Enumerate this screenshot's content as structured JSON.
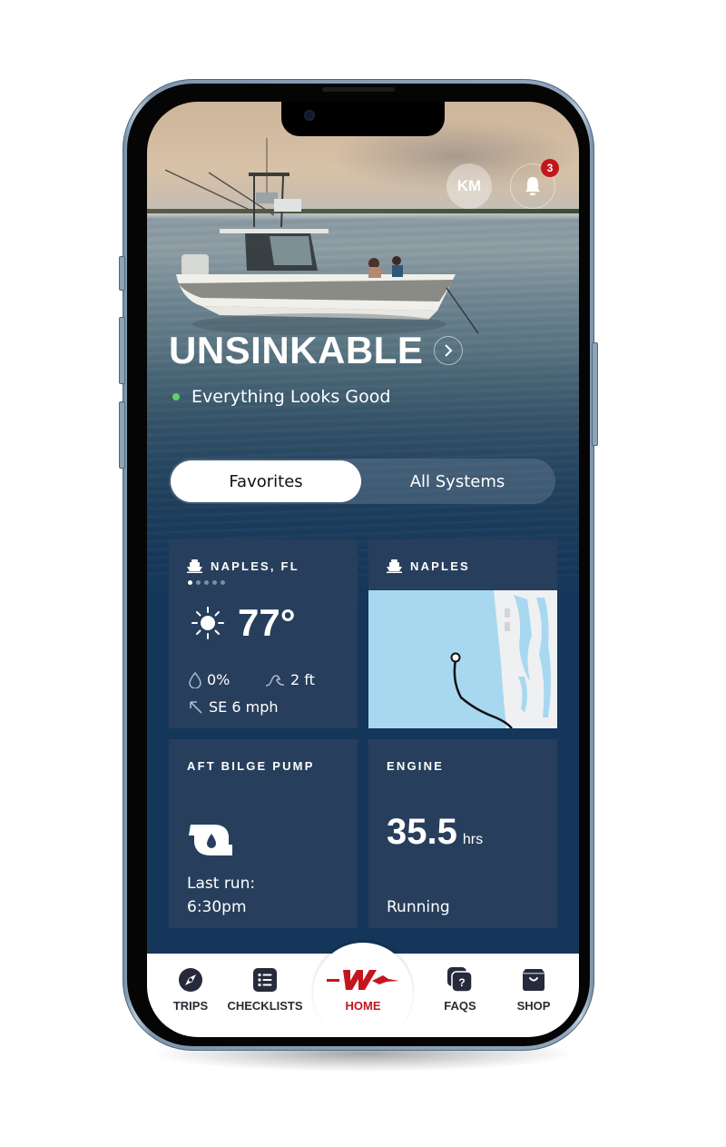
{
  "header": {
    "avatar_initials": "KM",
    "notification_count": "3"
  },
  "boat": {
    "name": "UNSINKABLE",
    "status": "Everything Looks Good",
    "status_color": "#5fd06a"
  },
  "segmented": {
    "options": [
      {
        "label": "Favorites",
        "selected": true
      },
      {
        "label": "All Systems",
        "selected": false
      }
    ]
  },
  "cards": {
    "weather": {
      "location": "NAPLES, FL",
      "page_count": 5,
      "active_page": 1,
      "temperature": "77°",
      "condition_icon": "sun-icon",
      "precipitation": "0%",
      "wave_height": "2 ft",
      "wind": "SE 6 mph"
    },
    "map": {
      "location": "NAPLES"
    },
    "bilge": {
      "title": "AFT BILGE PUMP",
      "last_run_label": "Last run:",
      "last_run_time": "6:30pm"
    },
    "engine": {
      "title": "ENGINE",
      "hours": "35.5",
      "unit": "hrs",
      "status": "Running"
    }
  },
  "tabbar": {
    "items": [
      {
        "label": "TRIPS",
        "icon": "compass-icon"
      },
      {
        "label": "CHECKLISTS",
        "icon": "checklist-icon"
      },
      {
        "label": "HOME",
        "icon": "brand-logo-icon",
        "active": true
      },
      {
        "label": "FAQS",
        "icon": "faq-icon"
      },
      {
        "label": "SHOP",
        "icon": "shop-bag-icon"
      }
    ],
    "active_color": "#c3161c"
  }
}
